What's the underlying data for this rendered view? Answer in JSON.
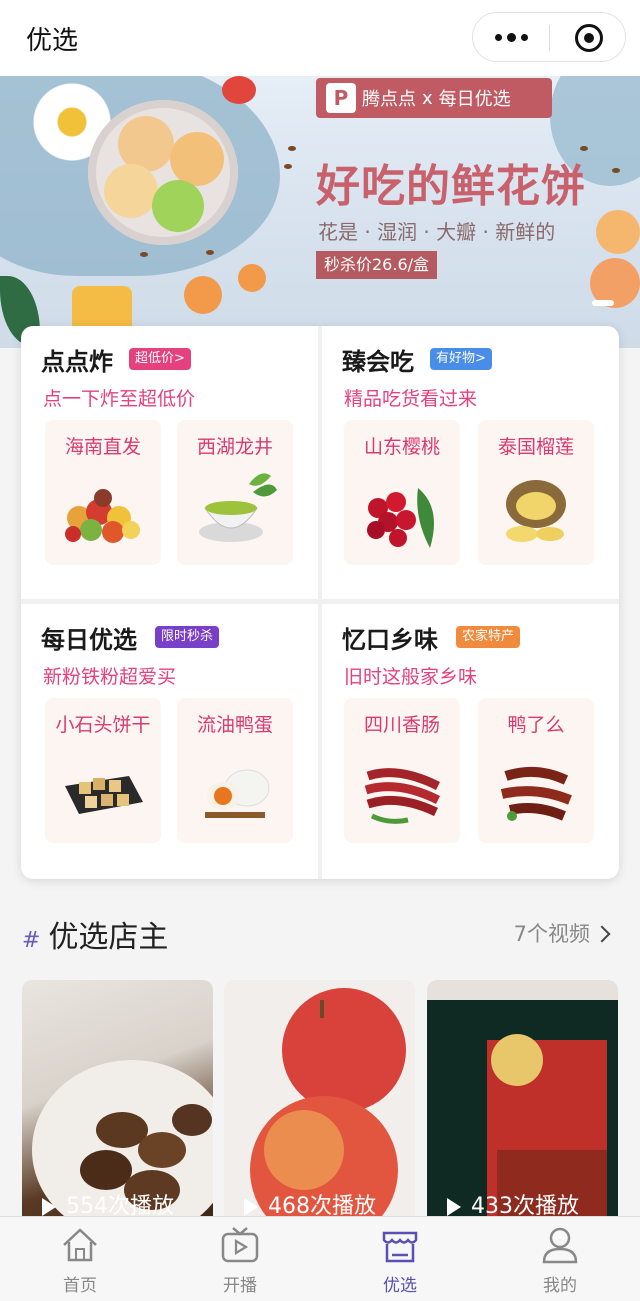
{
  "header": {
    "title": "优选"
  },
  "banner": {
    "brand": "腾点点",
    "brand_cross": "x",
    "brand_partner": "每日优选",
    "headline": "好吃的鲜花饼",
    "sub": "花是 · 湿润 · 大瓣 · 新鲜的",
    "price": "秒杀价26.6/盒"
  },
  "categories": [
    {
      "name": "点点炸",
      "tag": "超低价>",
      "tag_color": "#e5417e",
      "desc": "点一下炸至超低价",
      "items": [
        {
          "label": "海南直发",
          "icon": "fruit-basket-icon"
        },
        {
          "label": "西湖龙井",
          "icon": "green-tea-icon"
        }
      ]
    },
    {
      "name": "臻会吃",
      "tag": "有好物>",
      "tag_color": "#4a8de8",
      "desc": "精品吃货看过来",
      "items": [
        {
          "label": "山东樱桃",
          "icon": "cherry-icon"
        },
        {
          "label": "泰国榴莲",
          "icon": "durian-icon"
        }
      ]
    },
    {
      "name": "每日优选",
      "tag": "限时秒杀",
      "tag_color": "#7a3fc9",
      "desc": "新粉铁粉超爱买",
      "items": [
        {
          "label": "小石头饼干",
          "icon": "biscuit-icon"
        },
        {
          "label": "流油鸭蛋",
          "icon": "salted-egg-icon"
        }
      ]
    },
    {
      "name": "忆口乡味",
      "tag": "农家特产",
      "tag_color": "#f08a3c",
      "desc": "旧时这般家乡味",
      "items": [
        {
          "label": "四川香肠",
          "icon": "sausage-icon"
        },
        {
          "label": "鸭了么",
          "icon": "duck-neck-icon"
        }
      ]
    }
  ],
  "section": {
    "title": "优选店主",
    "more": "7个视频"
  },
  "videos": [
    {
      "plays": "554次播放"
    },
    {
      "plays": "468次播放"
    },
    {
      "plays": "433次播放"
    }
  ],
  "tabs": [
    {
      "label": "首页",
      "icon": "home-icon"
    },
    {
      "label": "开播",
      "icon": "tv-play-icon"
    },
    {
      "label": "优选",
      "icon": "shop-icon"
    },
    {
      "label": "我的",
      "icon": "user-icon"
    }
  ],
  "colors": {
    "accent": "#5a4fb3",
    "pink": "#e5417e"
  }
}
